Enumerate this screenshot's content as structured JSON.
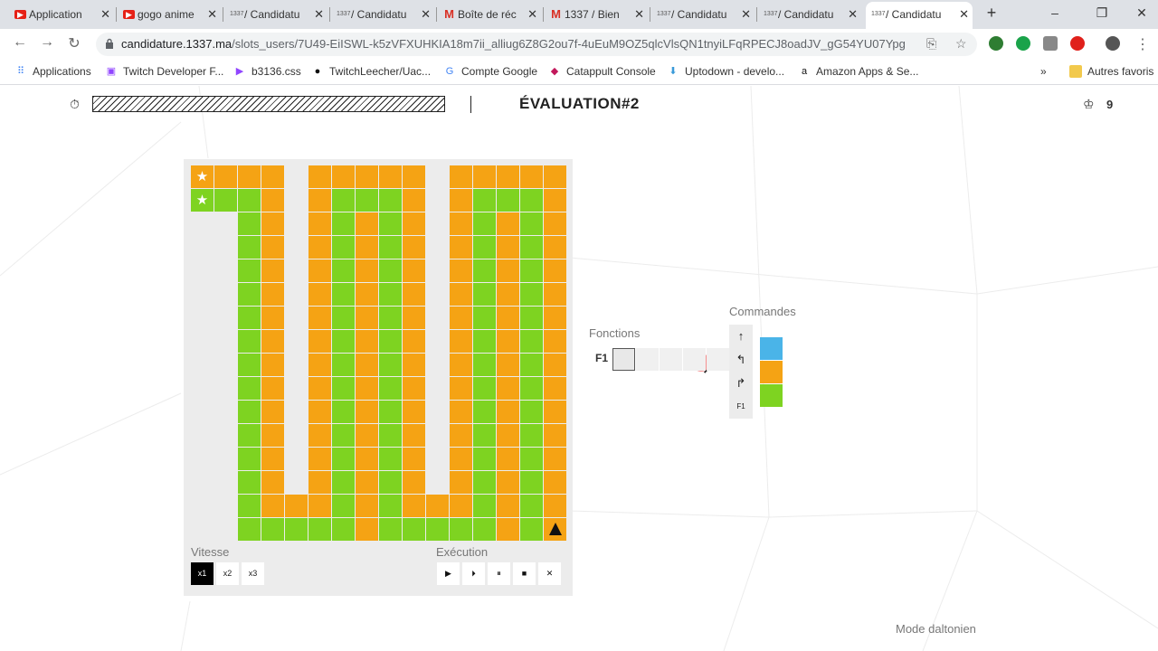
{
  "browser": {
    "tabs": [
      {
        "icon": "youtube-icon",
        "title": "Application"
      },
      {
        "icon": "youtube-icon",
        "title": "gogo anime"
      },
      {
        "icon": "1337-icon",
        "title": "/ Candidatu"
      },
      {
        "icon": "1337-icon",
        "title": "/ Candidatu"
      },
      {
        "icon": "gmail-icon",
        "title": "Boîte de réc"
      },
      {
        "icon": "gmail-icon",
        "title": "1337 / Bien"
      },
      {
        "icon": "1337-icon",
        "title": "/ Candidatu"
      },
      {
        "icon": "1337-icon",
        "title": "/ Candidatu"
      },
      {
        "icon": "1337-icon",
        "title": "/ Candidatu"
      }
    ],
    "tab_icon_text": "1337",
    "url_host": "candidature.1337.ma",
    "url_path": "/slots_users/7U49-EiISWL-k5zVFXUHKIA18m7ii_alliug6Z8G2ou7f-4uEuM9OZ5qlcVlsQN1tnyiLFqRPECJ8oadJV_gG54YU07Ypg",
    "bookmarks": [
      {
        "icon": "apps-grid-icon",
        "label": "Applications"
      },
      {
        "icon": "twitch-icon",
        "label": "Twitch Developer F..."
      },
      {
        "icon": "play-icon",
        "label": "b3136.css"
      },
      {
        "icon": "github-icon",
        "label": "TwitchLeecher/Uac..."
      },
      {
        "icon": "google-icon",
        "label": "Compte Google"
      },
      {
        "icon": "catappult-icon",
        "label": "Catappult Console"
      },
      {
        "icon": "uptodown-icon",
        "label": "Uptodown - develo..."
      },
      {
        "icon": "amazon-icon",
        "label": "Amazon Apps & Se..."
      }
    ],
    "more_bookmarks": "»",
    "other_bookmarks": "Autres favoris"
  },
  "header": {
    "title": "ÉVALUATION#2",
    "score": "9"
  },
  "board": {
    "rows": 16,
    "cols": 16,
    "grid": [
      "SOOO.OOOOO.OOOOO",
      "SGGO.OGGGO.OGGGO",
      "..GO.OGOGO.OGOGO",
      "..GO.OGOGO.OGOGO",
      "..GO.OGOGO.OGOGO",
      "..GO.OGOGO.OGOGO",
      "..GO.OGOGO.OGOGO",
      "..GO.OGOGO.OGOGO",
      "..GO.OGOGO.OGOGO",
      "..GO.OGOGO.OGOGO",
      "..GO.OGOGO.OGOGO",
      "..GO.OGOGO.OGOGO",
      "..GO.OGOGO.OGOGO",
      "..GO.OGOGO.OGOGO",
      "..GOOOGOGOOOGOGO",
      "..GGGGGOGGGGGOGA"
    ],
    "legend": {
      "O": "orange",
      "G": "green",
      "S": "star on orange/green",
      "A": "player arrow on orange",
      ".": "empty"
    }
  },
  "speed": {
    "label": "Vitesse",
    "options": [
      "x1",
      "x2",
      "x3"
    ],
    "selected": "x1"
  },
  "execution": {
    "label": "Exécution",
    "buttons": [
      {
        "name": "play-icon",
        "glyph": "▶"
      },
      {
        "name": "step-icon",
        "glyph": "⏵"
      },
      {
        "name": "pause-icon",
        "glyph": "⏸"
      },
      {
        "name": "stop-icon",
        "glyph": "■"
      },
      {
        "name": "clear-icon",
        "glyph": "✕"
      }
    ]
  },
  "functions": {
    "label": "Fonctions",
    "f1_label": "F1",
    "slots": 5
  },
  "commands": {
    "label": "Commandes",
    "buttons": [
      {
        "name": "forward-arrow-icon",
        "glyph": "↑"
      },
      {
        "name": "turn-left-icon",
        "glyph": "↰"
      },
      {
        "name": "turn-right-icon",
        "glyph": "↱"
      },
      {
        "name": "f1-command",
        "glyph": "F1"
      }
    ],
    "colors": [
      "#4ab4e8",
      "#f5a314",
      "#7ed321"
    ]
  },
  "colorblind_mode": "Mode daltonien",
  "colors": {
    "orange": "#f5a314",
    "green": "#7ed321",
    "blue": "#4ab4e8"
  }
}
